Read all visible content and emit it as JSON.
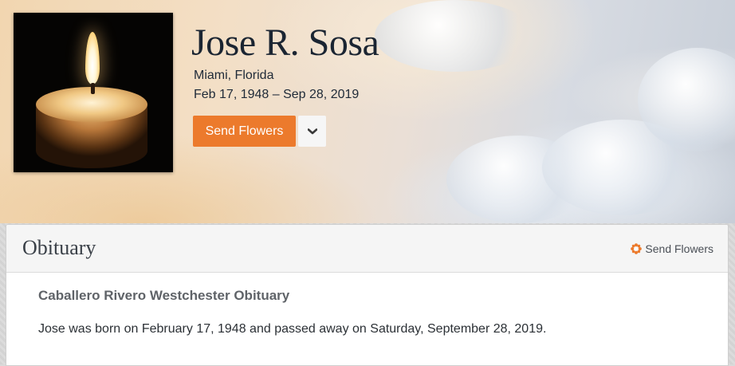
{
  "profile": {
    "name": "Jose R. Sosa",
    "location": "Miami, Florida",
    "dates": "Feb 17, 1948 – Sep 28, 2019",
    "send_flowers_label": "Send Flowers",
    "photo_icon": "candle-icon",
    "dropdown_icon": "chevron-down-icon"
  },
  "obituary": {
    "heading": "Obituary",
    "send_flowers_link": "Send Flowers",
    "link_icon": "flower-icon",
    "subheading": "Caballero Rivero Westchester Obituary",
    "text": "Jose was born on February 17, 1948 and passed away on Saturday, September 28, 2019."
  },
  "colors": {
    "accent": "#ec7a2c",
    "name_text": "#1b2532",
    "heading_text": "#3a4048"
  }
}
